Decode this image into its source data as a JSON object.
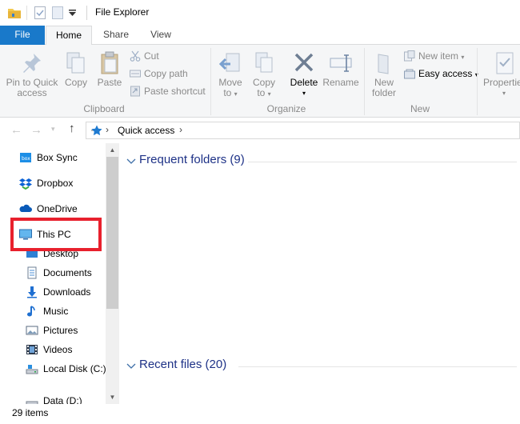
{
  "window": {
    "title": "File Explorer",
    "quick_access_toolbar": [
      "folder-icon",
      "properties-check-icon",
      "new-folder-icon",
      "customize-dropdown-icon"
    ]
  },
  "tabs": [
    {
      "label": "File",
      "active": false
    },
    {
      "label": "Home",
      "active": true
    },
    {
      "label": "Share",
      "active": false
    },
    {
      "label": "View",
      "active": false
    }
  ],
  "ribbon": {
    "clipboard": {
      "label": "Clipboard",
      "pin_line1": "Pin to Quick",
      "pin_line2": "access",
      "copy": "Copy",
      "paste": "Paste",
      "cut": "Cut",
      "copy_path": "Copy path",
      "paste_shortcut": "Paste shortcut"
    },
    "organize": {
      "label": "Organize",
      "move_line1": "Move",
      "move_line2": "to",
      "copy_line1": "Copy",
      "copy_line2": "to",
      "delete": "Delete",
      "rename": "Rename"
    },
    "new": {
      "label": "New",
      "new_folder_line1": "New",
      "new_folder_line2": "folder",
      "new_item": "New item",
      "easy_access": "Easy access"
    },
    "open": {
      "properties": "Properties"
    }
  },
  "address": {
    "path": "Quick access"
  },
  "nav_pane": [
    {
      "label": "Box Sync",
      "icon": "box-sync-icon"
    },
    {
      "label": "Dropbox",
      "icon": "dropbox-icon"
    },
    {
      "label": "OneDrive",
      "icon": "onedrive-icon"
    },
    {
      "label": "This PC",
      "icon": "this-pc-icon"
    },
    {
      "label": "Desktop",
      "icon": "desktop-icon"
    },
    {
      "label": "Documents",
      "icon": "documents-icon"
    },
    {
      "label": "Downloads",
      "icon": "downloads-icon"
    },
    {
      "label": "Music",
      "icon": "music-icon"
    },
    {
      "label": "Pictures",
      "icon": "pictures-icon"
    },
    {
      "label": "Videos",
      "icon": "videos-icon"
    },
    {
      "label": "Local Disk (C:)",
      "icon": "local-disk-icon"
    },
    {
      "label": "Data (D:)",
      "icon": "data-drive-icon"
    }
  ],
  "content": {
    "frequent_folders": "Frequent folders (9)",
    "recent_files": "Recent files (20)"
  },
  "status": {
    "item_count": "29 items"
  },
  "colors": {
    "file_tab": "#1979ca",
    "section_title": "#1e3287",
    "highlight_box": "#e8202d"
  }
}
